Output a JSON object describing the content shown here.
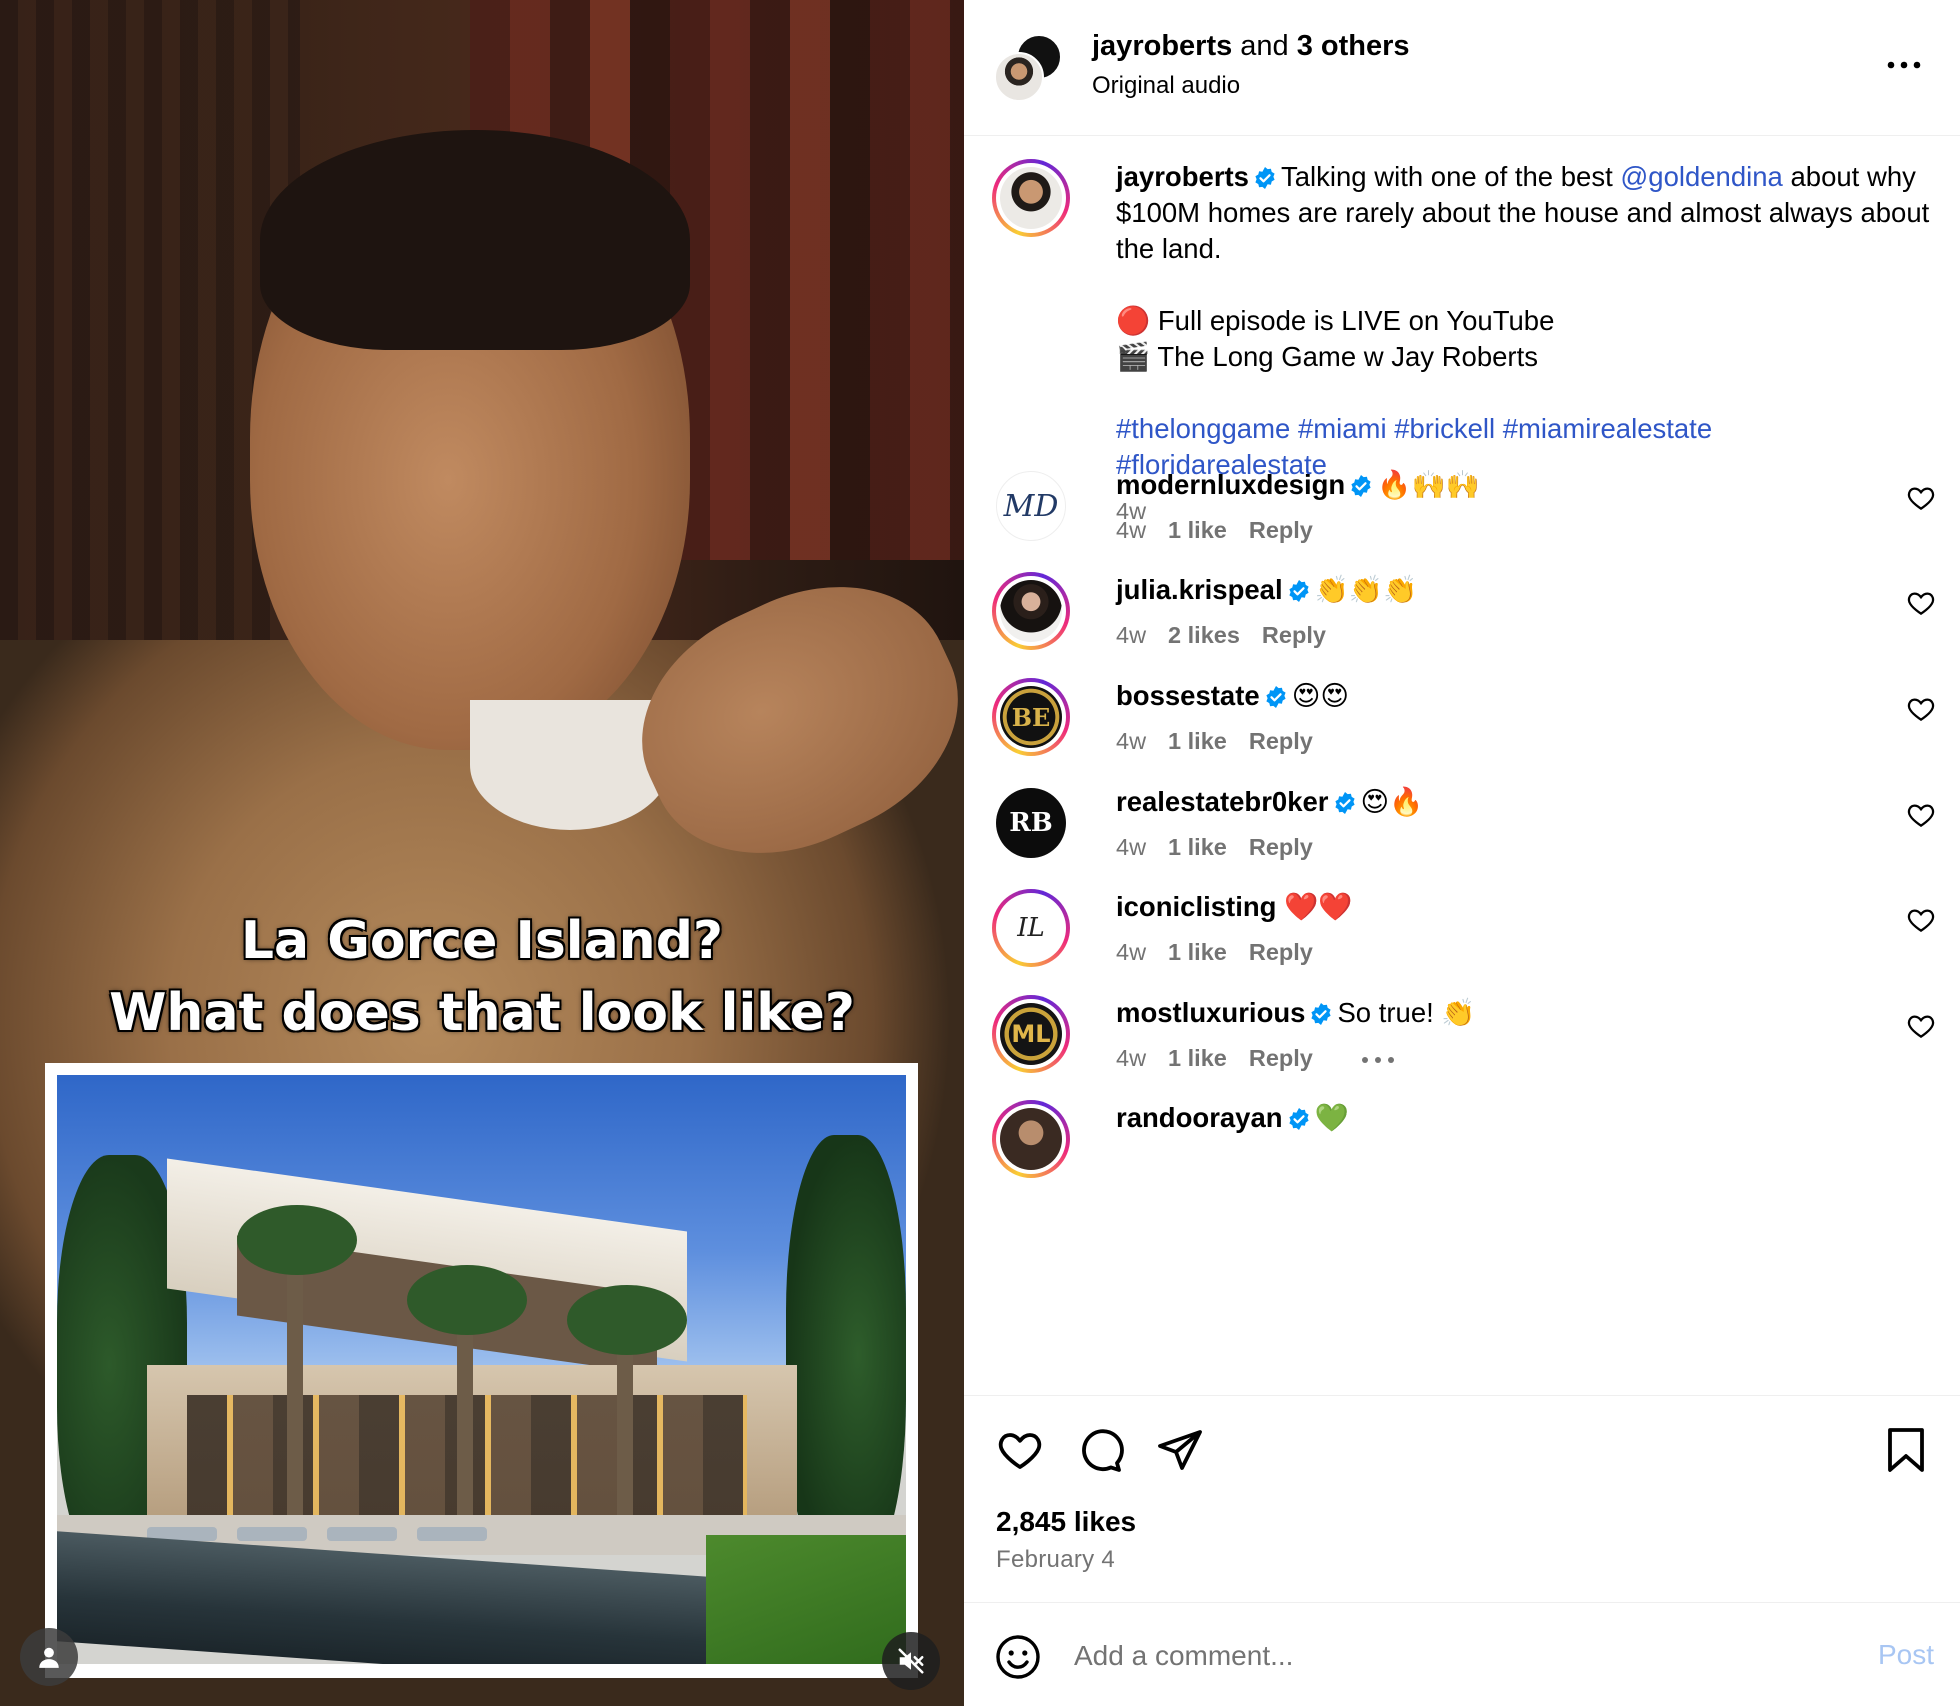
{
  "video": {
    "overlay_line1": "La Gorce Island?",
    "overlay_line2": "What does that look like?"
  },
  "header": {
    "username": "jayroberts",
    "and_text": "and",
    "others": "3 others",
    "subtitle": "Original audio"
  },
  "caption": {
    "username": "jayroberts",
    "text_before": "Talking with one of the best",
    "mention": "@goldendina",
    "text_after": "about why $100M homes are rarely about the house and almost always about the land.",
    "line_live": "🔴 Full episode is LIVE on YouTube",
    "line_show": "🎬 The Long Game w Jay Roberts",
    "hashtags_line1": "#thelonggame #miami #brickell #miamirealestate",
    "hashtags_line2": "#floridarealestate",
    "time": "4w"
  },
  "comments": [
    {
      "username": "modernluxdesign",
      "text": "🔥🙌🙌",
      "time": "4w",
      "likes": "1 like",
      "reply": "Reply",
      "avatar_letters": "MD"
    },
    {
      "username": "julia.krispeal",
      "text": "👏👏👏",
      "time": "4w",
      "likes": "2 likes",
      "reply": "Reply",
      "avatar_letters": ""
    },
    {
      "username": "bossestate",
      "text": "😍😍",
      "time": "4w",
      "likes": "1 like",
      "reply": "Reply",
      "avatar_letters": "BE"
    },
    {
      "username": "realestatebr0ker",
      "text": "😍🔥",
      "time": "4w",
      "likes": "1 like",
      "reply": "Reply",
      "avatar_letters": "RB"
    },
    {
      "username": "iconiclisting",
      "text": "❤️❤️",
      "time": "4w",
      "likes": "1 like",
      "reply": "Reply",
      "avatar_letters": "IL"
    },
    {
      "username": "mostluxurious",
      "text": "So true! 👏",
      "time": "4w",
      "likes": "1 like",
      "reply": "Reply",
      "avatar_letters": "ML"
    },
    {
      "username": "randoorayan",
      "text": "💚",
      "time": "",
      "likes": "",
      "reply": "",
      "avatar_letters": ""
    }
  ],
  "footer": {
    "likes": "2,845 likes",
    "date": "February 4"
  },
  "composer": {
    "placeholder": "Add a comment...",
    "post_label": "Post"
  },
  "colors": {
    "link_blue": "#2f56c7",
    "verified_blue": "#0095f6",
    "muted": "#737373",
    "post_disabled": "#a8c6f3"
  }
}
